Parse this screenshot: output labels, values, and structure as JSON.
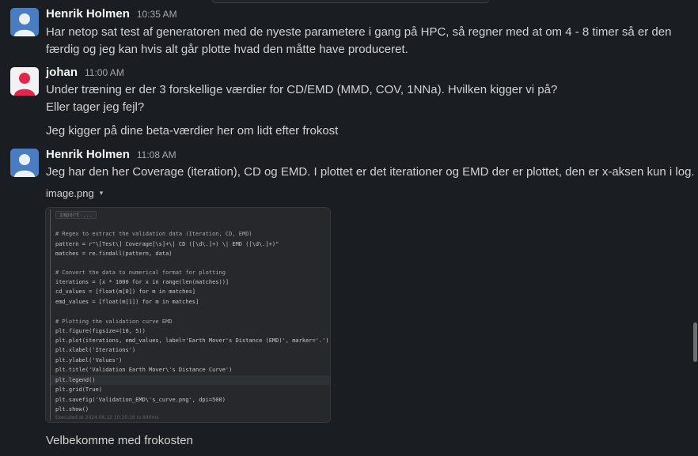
{
  "messages": [
    {
      "author": "Henrik Holmen",
      "time": "10:35 AM",
      "avatar_color": "#4a7cc2",
      "lines": [
        "Har netop sat test af generatoren med de nyeste parametere i gang på HPC, så regner med at om 4 - 8 timer så er den",
        "færdig og jeg kan hvis alt går plotte hvad den måtte have produceret."
      ]
    },
    {
      "author": "johan",
      "time": "11:00 AM",
      "avatar_color": "#e2264d",
      "lines": [
        "Under træning er der 3 forskellige værdier for CD/EMD (MMD, COV, 1NNa). Hvilken kigger vi på?",
        "Eller tager jeg fejl?",
        "Jeg kigger på dine beta-værdier her om lidt efter frokost"
      ]
    },
    {
      "author": "Henrik Holmen",
      "time": "11:08 AM",
      "avatar_color": "#4a7cc2",
      "lines": [
        "Jeg har den her Coverage (iteration), CD og EMD.  I plottet er det iterationer og EMD der er plottet, den er x-aksen kun i log."
      ],
      "file": {
        "name": "image.png",
        "caret": "▾",
        "code": {
          "fold_label": "import ...",
          "lines": [
            "# Regex to extract the validation data (Iteration, CD, EMD)",
            "pattern = r\"\\[Test\\] Coverage[\\s]+\\| CD ([\\d\\.]+) \\| EMD ([\\d\\.]+)\"",
            "matches = re.findall(pattern, data)",
            "",
            "# Convert the data to numerical format for plotting",
            "iterations = [x * 1000 for x in range(len(matches))]",
            "cd_values = [float(m[0]) for m in matches]",
            "emd_values = [float(m[1]) for m in matches]",
            "",
            "# Plotting the validation curve EMD",
            "plt.figure(figsize=(10, 5))",
            "plt.plot(iterations, emd_values, label='Earth Mover's Distance (EMD)', marker='.')",
            "plt.xlabel('Iterations')",
            "plt.ylabel('Values')",
            "plt.title('Validation Earth Mover\\'s Distance Curve')",
            "plt.legend()",
            "plt.grid(True)",
            "plt.savefig('Validation_EMD\\'s_curve.png', dpi=500)",
            "plt.show()"
          ],
          "footer": "Executed at 2024.06.12 10:20:16 in 840ms"
        }
      },
      "after_file": "Velbekomme med frokosten"
    }
  ]
}
